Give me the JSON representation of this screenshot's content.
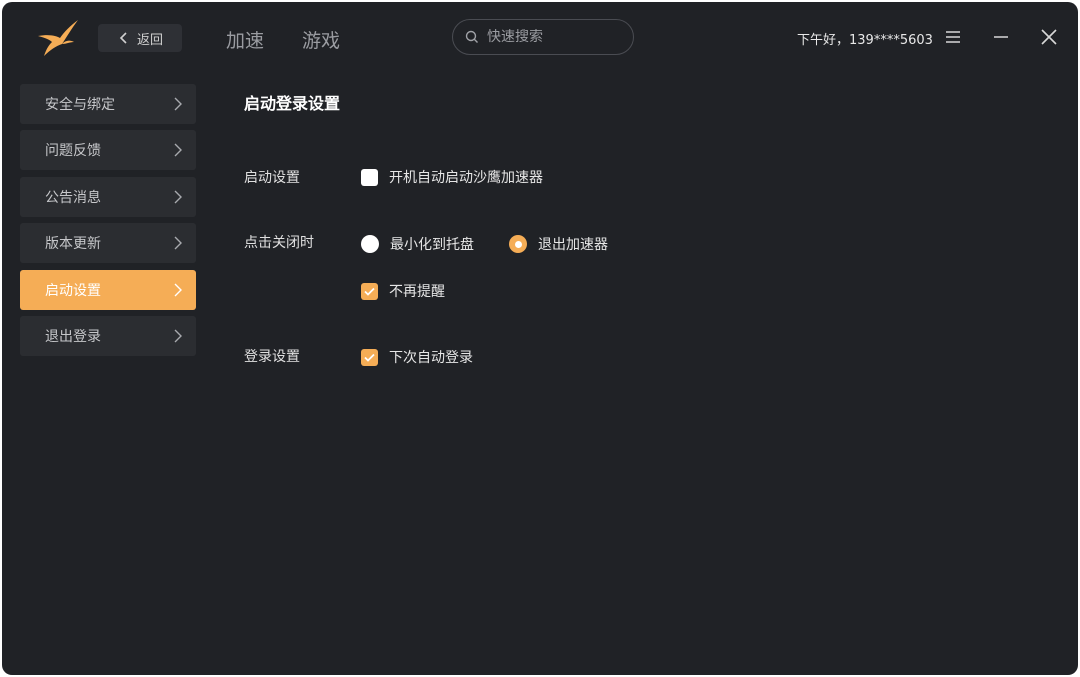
{
  "colors": {
    "accent": "#f5ad56",
    "window_bg": "#202226",
    "sidebar_item_bg": "#2b2d31"
  },
  "header": {
    "back_label": "返回",
    "tabs": [
      {
        "label": "加速"
      },
      {
        "label": "游戏"
      }
    ],
    "search": {
      "placeholder": "快速搜索",
      "value": ""
    },
    "greeting": "下午好，139****5603",
    "icons": {
      "logo": "bird-logo-icon",
      "menu": "hamburger-menu-icon",
      "minimize": "minimize-icon",
      "close": "close-icon"
    }
  },
  "sidebar": {
    "items": [
      {
        "label": "安全与绑定",
        "active": false
      },
      {
        "label": "问题反馈",
        "active": false
      },
      {
        "label": "公告消息",
        "active": false
      },
      {
        "label": "版本更新",
        "active": false
      },
      {
        "label": "启动设置",
        "active": true
      },
      {
        "label": "退出登录",
        "active": false
      }
    ]
  },
  "content": {
    "title": "启动登录设置",
    "startup": {
      "label": "启动设置",
      "auto_start": {
        "label": "开机自动启动沙鹰加速器",
        "checked": false
      }
    },
    "on_close": {
      "label": "点击关闭时",
      "options": [
        {
          "label": "最小化到托盘",
          "selected": false
        },
        {
          "label": "退出加速器",
          "selected": true
        }
      ],
      "no_remind": {
        "label": "不再提醒",
        "checked": true
      }
    },
    "login": {
      "label": "登录设置",
      "auto_login": {
        "label": "下次自动登录",
        "checked": true
      }
    }
  }
}
